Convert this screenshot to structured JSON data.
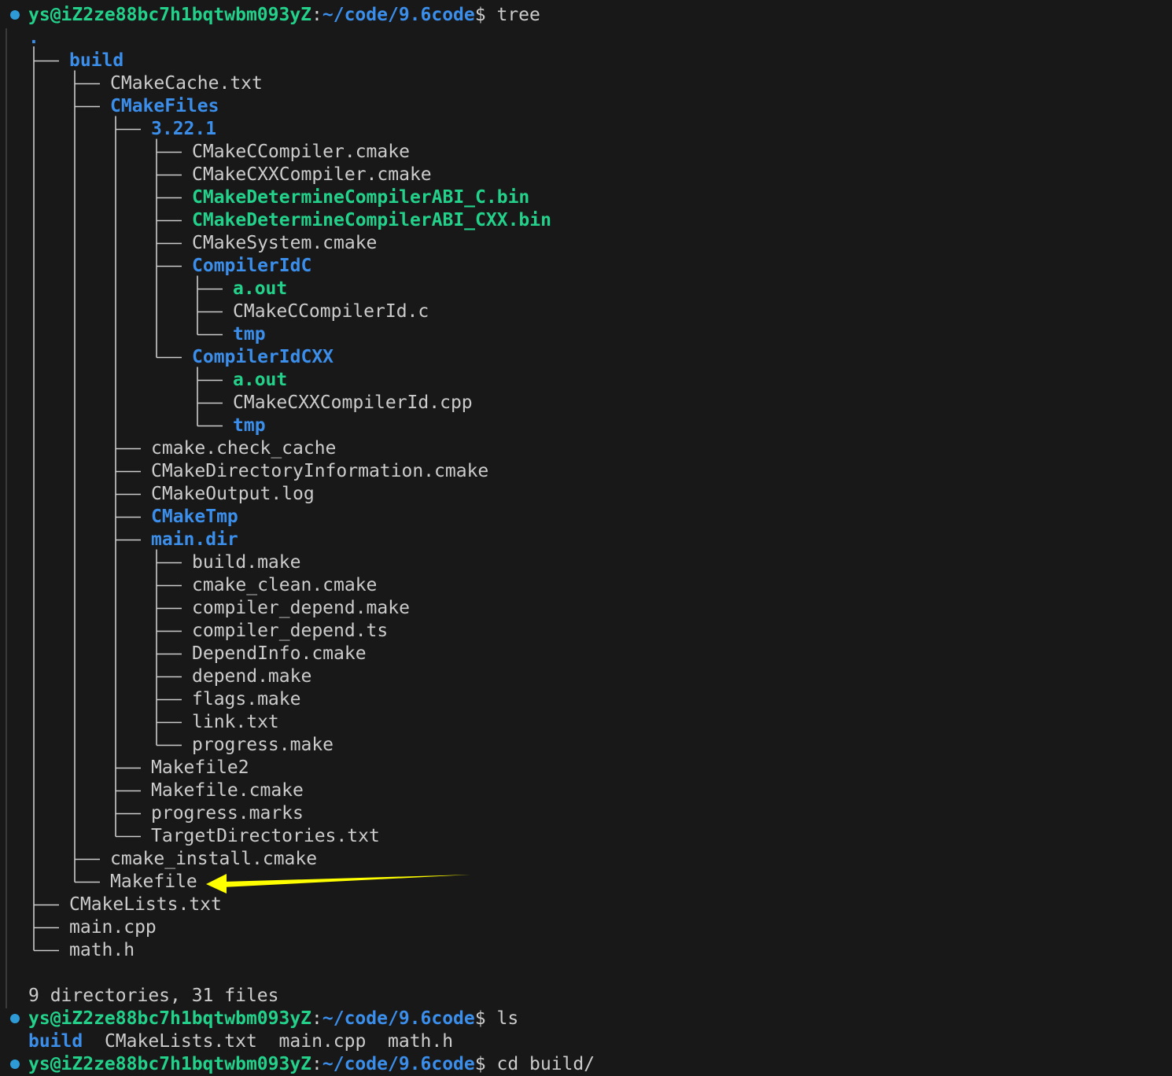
{
  "prompt": {
    "user_host": "ys@iZ2ze88bc7h1bqtwbm093yZ",
    "sep": ":",
    "path": "~/code/9.6code",
    "dollar": "$"
  },
  "commands": {
    "tree": " tree",
    "ls": " ls",
    "cd": " cd build/"
  },
  "tree": {
    "root": ".",
    "rows": [
      {
        "depth": 1,
        "name": "build",
        "kind": "dir"
      },
      {
        "depth": 2,
        "name": "CMakeCache.txt",
        "kind": "file"
      },
      {
        "depth": 2,
        "name": "CMakeFiles",
        "kind": "dir"
      },
      {
        "depth": 3,
        "name": "3.22.1",
        "kind": "dir"
      },
      {
        "depth": 4,
        "name": "CMakeCCompiler.cmake",
        "kind": "file"
      },
      {
        "depth": 4,
        "name": "CMakeCXXCompiler.cmake",
        "kind": "file"
      },
      {
        "depth": 4,
        "name": "CMakeDetermineCompilerABI_C.bin",
        "kind": "exec"
      },
      {
        "depth": 4,
        "name": "CMakeDetermineCompilerABI_CXX.bin",
        "kind": "exec"
      },
      {
        "depth": 4,
        "name": "CMakeSystem.cmake",
        "kind": "file"
      },
      {
        "depth": 4,
        "name": "CompilerIdC",
        "kind": "dir"
      },
      {
        "depth": 5,
        "name": "a.out",
        "kind": "exec"
      },
      {
        "depth": 5,
        "name": "CMakeCCompilerId.c",
        "kind": "file"
      },
      {
        "depth": 5,
        "name": "tmp",
        "kind": "dir"
      },
      {
        "depth": 4,
        "name": "CompilerIdCXX",
        "kind": "dir"
      },
      {
        "depth": 5,
        "name": "a.out",
        "kind": "exec"
      },
      {
        "depth": 5,
        "name": "CMakeCXXCompilerId.cpp",
        "kind": "file"
      },
      {
        "depth": 5,
        "name": "tmp",
        "kind": "dir"
      },
      {
        "depth": 3,
        "name": "cmake.check_cache",
        "kind": "file"
      },
      {
        "depth": 3,
        "name": "CMakeDirectoryInformation.cmake",
        "kind": "file"
      },
      {
        "depth": 3,
        "name": "CMakeOutput.log",
        "kind": "file"
      },
      {
        "depth": 3,
        "name": "CMakeTmp",
        "kind": "dir"
      },
      {
        "depth": 3,
        "name": "main.dir",
        "kind": "dir"
      },
      {
        "depth": 4,
        "name": "build.make",
        "kind": "file"
      },
      {
        "depth": 4,
        "name": "cmake_clean.cmake",
        "kind": "file"
      },
      {
        "depth": 4,
        "name": "compiler_depend.make",
        "kind": "file"
      },
      {
        "depth": 4,
        "name": "compiler_depend.ts",
        "kind": "file"
      },
      {
        "depth": 4,
        "name": "DependInfo.cmake",
        "kind": "file"
      },
      {
        "depth": 4,
        "name": "depend.make",
        "kind": "file"
      },
      {
        "depth": 4,
        "name": "flags.make",
        "kind": "file"
      },
      {
        "depth": 4,
        "name": "link.txt",
        "kind": "file"
      },
      {
        "depth": 4,
        "name": "progress.make",
        "kind": "file"
      },
      {
        "depth": 3,
        "name": "Makefile2",
        "kind": "file"
      },
      {
        "depth": 3,
        "name": "Makefile.cmake",
        "kind": "file"
      },
      {
        "depth": 3,
        "name": "progress.marks",
        "kind": "file"
      },
      {
        "depth": 3,
        "name": "TargetDirectories.txt",
        "kind": "file"
      },
      {
        "depth": 2,
        "name": "cmake_install.cmake",
        "kind": "file"
      },
      {
        "depth": 2,
        "name": "Makefile",
        "kind": "file"
      },
      {
        "depth": 1,
        "name": "CMakeLists.txt",
        "kind": "file"
      },
      {
        "depth": 1,
        "name": "main.cpp",
        "kind": "file"
      },
      {
        "depth": 1,
        "name": "math.h",
        "kind": "file"
      }
    ]
  },
  "summary": "9 directories, 31 files",
  "ls_output": [
    {
      "name": "build",
      "kind": "dir"
    },
    {
      "name": "CMakeLists.txt",
      "kind": "file"
    },
    {
      "name": "main.cpp",
      "kind": "file"
    },
    {
      "name": "math.h",
      "kind": "file"
    }
  ],
  "colors": {
    "background": "#181818",
    "text": "#cccccc",
    "directory": "#3b8eea",
    "executable": "#23d18b",
    "prompt_host": "#23d18b",
    "prompt_path": "#3b8eea",
    "status_dot": "#2f9bd6",
    "annotation_arrow": "#ffff00"
  },
  "annotation": {
    "type": "arrow",
    "points_to": "Makefile"
  }
}
